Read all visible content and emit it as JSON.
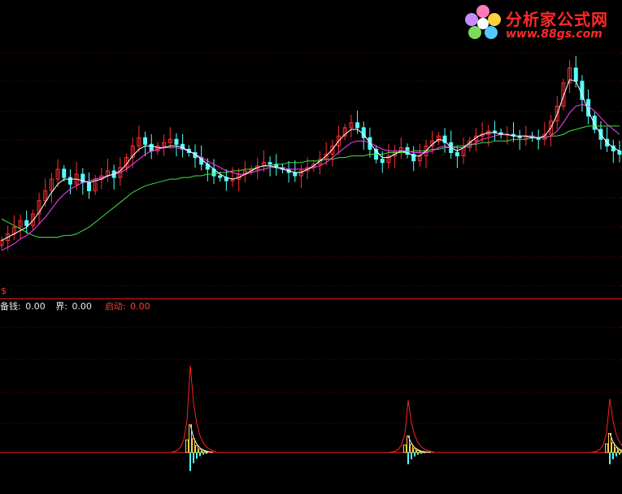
{
  "watermark": {
    "brand": "分析家公式网",
    "url": "www.88gs.com"
  },
  "indicator": {
    "marker": "$",
    "items": [
      {
        "label": "备钱:",
        "value": "0.00",
        "color": "#e8e8e8"
      },
      {
        "label": "界:",
        "value": "0.00",
        "color": "#e8e8e8"
      },
      {
        "label": "启动:",
        "value": "0.00",
        "color": "#ff3b3b"
      }
    ]
  },
  "colors": {
    "background": "#000000",
    "up_candle": "#ff3030",
    "down_candle": "#54ffff",
    "ma_white": "#ffffff",
    "ma_magenta": "#ff40ff",
    "ma_green": "#40e040",
    "spike": "#ff2020",
    "grid": "#7a0000",
    "baseline": "#ff2020",
    "bar_yellow": "#ffd24a",
    "bar_cyan": "#54ffff"
  },
  "chart_data": [
    {
      "type": "candlestick",
      "panel": "price",
      "grid": true,
      "close": [
        10.2,
        10.6,
        11.0,
        11.4,
        11.1,
        11.8,
        12.6,
        13.2,
        13.9,
        14.5,
        14.0,
        13.6,
        14.2,
        13.7,
        13.2,
        13.9,
        14.1,
        14.4,
        14.0,
        14.6,
        15.2,
        15.9,
        16.4,
        16.0,
        15.6,
        15.9,
        16.1,
        16.3,
        16.0,
        15.7,
        15.5,
        15.2,
        14.8,
        14.5,
        14.1,
        14.0,
        13.8,
        13.9,
        14.2,
        14.4,
        14.5,
        14.7,
        14.9,
        14.8,
        14.6,
        14.5,
        14.3,
        14.1,
        14.4,
        14.6,
        14.8,
        15.1,
        15.4,
        15.9,
        16.5,
        17.0,
        17.3,
        17.0,
        16.4,
        15.7,
        15.1,
        14.9,
        15.3,
        15.6,
        15.8,
        15.4,
        15.0,
        15.3,
        15.9,
        16.2,
        16.5,
        16.1,
        15.5,
        15.3,
        15.8,
        16.2,
        16.5,
        16.6,
        16.8,
        16.7,
        16.6,
        16.6,
        16.5,
        16.4,
        16.5,
        16.4,
        16.3,
        16.6,
        17.4,
        18.3,
        19.7,
        20.6,
        19.8,
        18.7,
        17.7,
        16.9,
        16.3,
        15.9,
        15.6,
        15.4
      ],
      "ma_white": [
        10.2,
        10.4,
        10.6,
        10.8,
        11.0,
        11.4,
        11.9,
        12.5,
        13.1,
        13.6,
        13.9,
        13.9,
        13.9,
        13.8,
        13.7,
        13.8,
        13.9,
        14.1,
        14.2,
        14.4,
        14.8,
        15.3,
        15.7,
        15.9,
        15.9,
        15.8,
        15.8,
        15.9,
        15.9,
        15.8,
        15.6,
        15.4,
        15.1,
        14.8,
        14.5,
        14.2,
        14.0,
        13.9,
        14.0,
        14.2,
        14.4,
        14.6,
        14.7,
        14.7,
        14.6,
        14.5,
        14.4,
        14.3,
        14.3,
        14.5,
        14.7,
        15.0,
        15.3,
        15.7,
        16.2,
        16.6,
        16.9,
        16.9,
        16.6,
        16.1,
        15.6,
        15.2,
        15.2,
        15.4,
        15.6,
        15.5,
        15.3,
        15.3,
        15.6,
        16.0,
        16.3,
        16.2,
        15.8,
        15.6,
        15.8,
        16.1,
        16.4,
        16.6,
        16.7,
        16.7,
        16.6,
        16.6,
        16.5,
        16.5,
        16.5,
        16.4,
        16.4,
        16.5,
        17.0,
        17.8,
        18.9,
        19.9,
        19.8,
        19.0,
        18.0,
        17.2,
        16.6,
        16.1,
        15.8,
        15.6
      ],
      "ma_magenta": [
        9.6,
        9.8,
        10.0,
        10.3,
        10.5,
        10.8,
        11.2,
        11.6,
        12.1,
        12.6,
        13.0,
        13.3,
        13.5,
        13.7,
        13.8,
        13.9,
        14.0,
        14.1,
        14.2,
        14.3,
        14.5,
        14.8,
        15.1,
        15.4,
        15.6,
        15.7,
        15.8,
        15.8,
        15.8,
        15.7,
        15.6,
        15.4,
        15.2,
        15.0,
        14.8,
        14.6,
        14.4,
        14.3,
        14.2,
        14.2,
        14.3,
        14.4,
        14.5,
        14.6,
        14.6,
        14.6,
        14.5,
        14.5,
        14.5,
        14.5,
        14.6,
        14.7,
        14.9,
        15.2,
        15.5,
        15.8,
        16.1,
        16.2,
        16.2,
        16.1,
        15.9,
        15.7,
        15.6,
        15.6,
        15.6,
        15.6,
        15.5,
        15.5,
        15.5,
        15.6,
        15.8,
        15.9,
        15.8,
        15.8,
        15.8,
        15.9,
        16.1,
        16.3,
        16.4,
        16.5,
        16.6,
        16.6,
        16.5,
        16.5,
        16.5,
        16.5,
        16.4,
        16.4,
        16.5,
        16.8,
        17.3,
        17.9,
        18.3,
        18.4,
        18.3,
        18.0,
        17.6,
        17.2,
        16.9,
        16.6
      ],
      "ma_green": [
        11.5,
        11.3,
        11.1,
        10.9,
        10.7,
        10.5,
        10.4,
        10.4,
        10.4,
        10.4,
        10.5,
        10.5,
        10.6,
        10.8,
        11.0,
        11.3,
        11.6,
        11.9,
        12.2,
        12.5,
        12.8,
        13.1,
        13.3,
        13.5,
        13.6,
        13.7,
        13.8,
        13.9,
        13.9,
        14.0,
        14.0,
        14.1,
        14.1,
        14.2,
        14.2,
        14.3,
        14.3,
        14.4,
        14.4,
        14.5,
        14.5,
        14.6,
        14.7,
        14.7,
        14.8,
        14.8,
        14.9,
        14.9,
        14.9,
        15.0,
        15.0,
        15.0,
        15.1,
        15.1,
        15.2,
        15.2,
        15.3,
        15.3,
        15.3,
        15.4,
        15.4,
        15.4,
        15.5,
        15.5,
        15.5,
        15.5,
        15.6,
        15.6,
        15.6,
        15.7,
        15.7,
        15.8,
        15.8,
        15.9,
        15.9,
        16.0,
        16.0,
        16.1,
        16.1,
        16.2,
        16.2,
        16.2,
        16.3,
        16.3,
        16.3,
        16.4,
        16.4,
        16.4,
        16.5,
        16.5,
        16.6,
        16.8,
        16.9,
        17.0,
        17.1,
        17.1,
        17.1,
        17.1,
        17.1,
        17.1
      ]
    },
    {
      "type": "bar",
      "panel": "indicator",
      "grid": true,
      "series": [
        {
          "role": "spike",
          "peaks": [
            {
              "index": 58,
              "value": 100
            },
            {
              "index": 125,
              "value": 60
            },
            {
              "index": 187,
              "value": 62
            }
          ]
        },
        {
          "role": "yellow-bars",
          "peaks": [
            {
              "index": 58,
              "value": 32
            },
            {
              "index": 125,
              "value": 19
            },
            {
              "index": 187,
              "value": 22
            }
          ]
        },
        {
          "role": "cyan-bars",
          "peaks": [
            {
              "index": 58,
              "value": -19
            },
            {
              "index": 125,
              "value": -12
            },
            {
              "index": 187,
              "value": -12
            }
          ]
        }
      ],
      "x_count": 191,
      "ylim": [
        -30,
        120
      ]
    }
  ]
}
